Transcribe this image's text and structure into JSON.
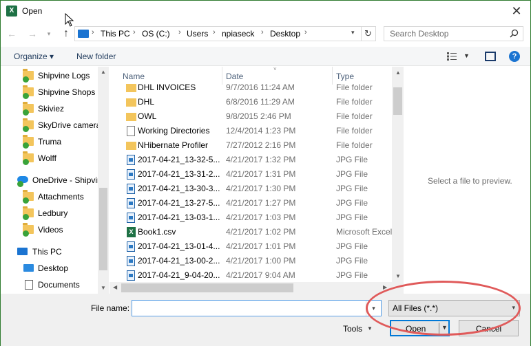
{
  "window": {
    "title": "Open",
    "app_icon": "excel-icon"
  },
  "address": {
    "crumbs": [
      "This PC",
      "OS (C:)",
      "Users",
      "npiaseck",
      "Desktop"
    ],
    "search_placeholder": "Search Desktop"
  },
  "toolbar": {
    "organize": "Organize ▾",
    "new_folder": "New folder"
  },
  "nav": {
    "items": [
      {
        "label": "Shipvine Logs",
        "icon": "folder-icon"
      },
      {
        "label": "Shipvine Shops",
        "icon": "folder-icon"
      },
      {
        "label": "Skiviez",
        "icon": "folder-icon"
      },
      {
        "label": "SkyDrive camera",
        "icon": "folder-icon"
      },
      {
        "label": "Truma",
        "icon": "folder-icon"
      },
      {
        "label": "Wolff",
        "icon": "folder-icon"
      },
      {
        "label": "OneDrive - Shipvine",
        "icon": "onedrive-icon"
      },
      {
        "label": "Attachments",
        "icon": "folder-icon"
      },
      {
        "label": "Ledbury",
        "icon": "folder-icon"
      },
      {
        "label": "Videos",
        "icon": "folder-icon"
      },
      {
        "label": "This PC",
        "icon": "pc-icon"
      },
      {
        "label": "Desktop",
        "icon": "desktop-icon"
      },
      {
        "label": "Documents",
        "icon": "documents-icon"
      }
    ]
  },
  "columns": {
    "name": "Name",
    "date": "Date",
    "type": "Type"
  },
  "files": [
    {
      "name": "DHL INVOICES",
      "date": "9/7/2016 11:24 AM",
      "type": "File folder",
      "icon": "folder"
    },
    {
      "name": "DHL",
      "date": "6/8/2016 11:29 AM",
      "type": "File folder",
      "icon": "folder"
    },
    {
      "name": "OWL",
      "date": "9/8/2015 2:46 PM",
      "type": "File folder",
      "icon": "folder"
    },
    {
      "name": "Working Directories",
      "date": "12/4/2014 1:23 PM",
      "type": "File folder",
      "icon": "folder"
    },
    {
      "name": "NHibernate Profiler",
      "date": "7/27/2012 2:16 PM",
      "type": "File folder",
      "icon": "folder"
    },
    {
      "name": "2017-04-21_13-32-5...",
      "date": "4/21/2017 1:32 PM",
      "type": "JPG File",
      "icon": "jpg"
    },
    {
      "name": "2017-04-21_13-31-2...",
      "date": "4/21/2017 1:31 PM",
      "type": "JPG File",
      "icon": "jpg"
    },
    {
      "name": "2017-04-21_13-30-3...",
      "date": "4/21/2017 1:30 PM",
      "type": "JPG File",
      "icon": "jpg"
    },
    {
      "name": "2017-04-21_13-27-5...",
      "date": "4/21/2017 1:27 PM",
      "type": "JPG File",
      "icon": "jpg"
    },
    {
      "name": "2017-04-21_13-03-1...",
      "date": "4/21/2017 1:03 PM",
      "type": "JPG File",
      "icon": "jpg"
    },
    {
      "name": "Book1.csv",
      "date": "4/21/2017 1:02 PM",
      "type": "Microsoft Excel",
      "icon": "csv"
    },
    {
      "name": "2017-04-21_13-01-4...",
      "date": "4/21/2017 1:01 PM",
      "type": "JPG File",
      "icon": "jpg"
    },
    {
      "name": "2017-04-21_13-00-2...",
      "date": "4/21/2017 1:00 PM",
      "type": "JPG File",
      "icon": "jpg"
    },
    {
      "name": "2017-04-21_9-04-20...",
      "date": "4/21/2017 9:04 AM",
      "type": "JPG File",
      "icon": "jpg"
    }
  ],
  "preview": {
    "text": "Select a file to preview."
  },
  "bottom": {
    "file_name_label": "File name:",
    "file_name_value": "",
    "filter_value": "All Files (*.*)",
    "tools_label": "Tools",
    "open_label": "Open",
    "cancel_label": "Cancel"
  },
  "colors": {
    "accent": "#0078d7",
    "annotation": "#e05a5a",
    "folder": "#f3c55c"
  }
}
